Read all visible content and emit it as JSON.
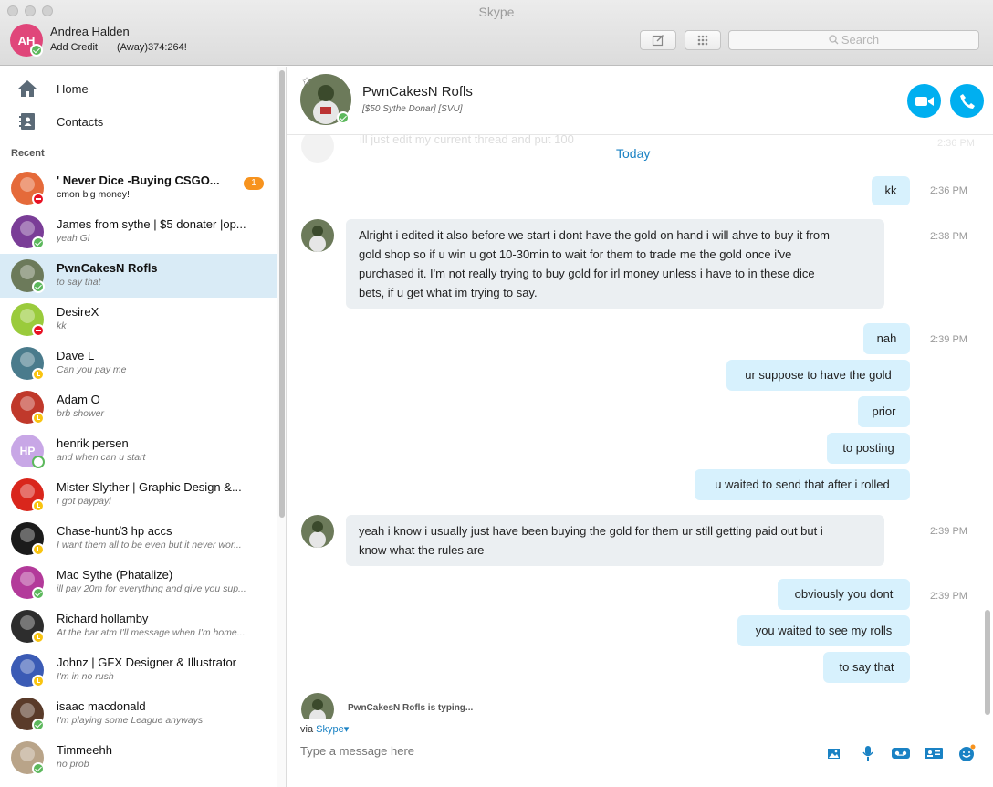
{
  "window": {
    "title": "Skype"
  },
  "profile": {
    "initials": "AH",
    "name": "Andrea Halden",
    "credit": "Add Credit",
    "mood": "(Away)374:264!"
  },
  "search": {
    "placeholder": "Search"
  },
  "nav": {
    "home": "Home",
    "contacts": "Contacts",
    "recent_label": "Recent"
  },
  "contacts": [
    {
      "name": "' Never Dice -Buying CSGO...",
      "msg": "cmon big money!",
      "status": "busy",
      "badge": "1",
      "bold": true,
      "color": "#e56a3a"
    },
    {
      "name": "James from sythe | $5 donater |op...",
      "msg": "yeah Gl",
      "status": "online",
      "color": "#7a3d97"
    },
    {
      "name": "PwnCakesN Rofls",
      "msg": "to say that",
      "status": "online",
      "bold": true,
      "active": true,
      "color": "#6c7a5a"
    },
    {
      "name": "DesireX",
      "msg": "kk",
      "status": "busy",
      "color": "#9acb3c"
    },
    {
      "name": "Dave L",
      "msg": "Can you pay me",
      "status": "away",
      "color": "#4a7b8c"
    },
    {
      "name": "Adam O",
      "msg": "brb shower",
      "status": "away",
      "color": "#c0392b"
    },
    {
      "name": "henrik persen",
      "initials": "HP",
      "msg": "and when can u start",
      "status": "offline",
      "color": "#c8a7e6"
    },
    {
      "name": "Mister Slyther | Graphic Design &...",
      "msg": "I got paypayl",
      "status": "away",
      "color": "#d9261c"
    },
    {
      "name": "Chase-hunt/3 hp accs",
      "msg": "I want them all to be even but it never wor...",
      "status": "away",
      "color": "#1b1b1b"
    },
    {
      "name": "Mac Sythe (Phatalize)",
      "msg": "ill pay 20m for everything and give you sup...",
      "status": "online",
      "color": "#b33a9a"
    },
    {
      "name": "Richard hollamby",
      "msg": "At the bar atm I'll message when I'm home...",
      "status": "away",
      "color": "#2d2d2d"
    },
    {
      "name": "Johnz | GFX Designer & Illustrator",
      "msg": "I'm in no rush",
      "status": "away",
      "color": "#3b5bb5"
    },
    {
      "name": "isaac macdonald",
      "msg": "I'm playing some League anyways",
      "status": "online",
      "color": "#5a3b2a"
    },
    {
      "name": "Timmeehh",
      "msg": "no prob",
      "status": "online",
      "color": "#b9a489"
    }
  ],
  "chat": {
    "name": "PwnCakesN Rofls",
    "mood": "[$50 Sythe Donar] [SVU]",
    "ghost_text": "ill just edit my current thread and put 100",
    "ghost_time": "2:36 PM",
    "today": "Today",
    "messages": [
      {
        "dir": "out",
        "text": "kk",
        "time": "2:36 PM"
      },
      {
        "dir": "in",
        "lines": [
          "Alright i edited it also before we start i dont have the gold on hand i will ahve to buy it from",
          "gold shop so if u win u got 10-30min to wait for them to trade me the gold once i've",
          "purchased it. I'm not really trying to buy gold for irl money unless i have to in these dice",
          "bets, if u get what im trying to say."
        ],
        "time": "2:38 PM"
      },
      {
        "dir": "out",
        "text": "nah",
        "time": "2:39 PM"
      },
      {
        "dir": "out",
        "text": "ur suppose to have the gold"
      },
      {
        "dir": "out",
        "text": "prior"
      },
      {
        "dir": "out",
        "text": "to posting"
      },
      {
        "dir": "out",
        "text": "u waited to send that after i rolled"
      },
      {
        "dir": "in",
        "lines": [
          "yeah i know i usually just have been buying the gold for them ur still getting paid out but i",
          "know what the rules are"
        ],
        "time": "2:39 PM"
      },
      {
        "dir": "out",
        "text": "obviously you dont",
        "time": "2:39 PM"
      },
      {
        "dir": "out",
        "text": "you waited to see my rolls"
      },
      {
        "dir": "out",
        "text": "to say that"
      }
    ],
    "typing": "PwnCakesN Rofls is typing..."
  },
  "composer": {
    "via": "via",
    "via_link": "Skype",
    "placeholder": "Type a message here"
  },
  "colors": {
    "accent": "#00aff0",
    "bubble_in": "#ebeff2",
    "bubble_out": "#d7f1fd",
    "active_row": "#d9ebf6"
  }
}
